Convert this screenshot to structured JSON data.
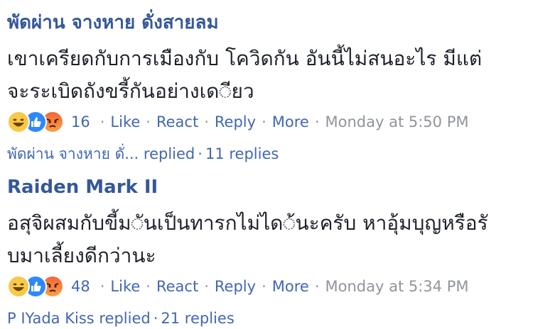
{
  "colors": {
    "author": "#365899",
    "link": "#4267b2",
    "text": "#1d2129",
    "muted": "#90949c"
  },
  "comments": [
    {
      "author": "พัดผ่าน จางหาย ดั่งสายลม",
      "body_lines": [
        "เขาเครียดกับการเมืองกับ โควิดกัน อันนี้ไม่สนอะไร มีแต่",
        "จะระเบิดถังขรี้กันอย่างเด◌ียว"
      ],
      "reactions": [
        "haha-icon",
        "like-icon",
        "angry-icon"
      ],
      "reaction_count": "16",
      "actions": [
        "Like",
        "React",
        "Reply",
        "More"
      ],
      "time": "Monday at 5:50 PM",
      "reply_by": "พัดผ่าน จางหาย ดั่... replied",
      "reply_count": "11 replies"
    },
    {
      "author": "Raiden Mark II",
      "body_lines": [
        "อสุจิผสมกับขี้ม◌ันเป็นทารกไม่ได◌้นะครับ หาอุ้มบุญหรือรั",
        "บมาเลี้ยงดีกว่านะ"
      ],
      "reactions": [
        "haha-icon",
        "like-icon",
        "angry-icon"
      ],
      "reaction_count": "48",
      "actions": [
        "Like",
        "React",
        "Reply",
        "More"
      ],
      "time": "Monday at 5:34 PM",
      "reply_by": "P IYada Kiss replied",
      "reply_count": "21 replies"
    }
  ]
}
